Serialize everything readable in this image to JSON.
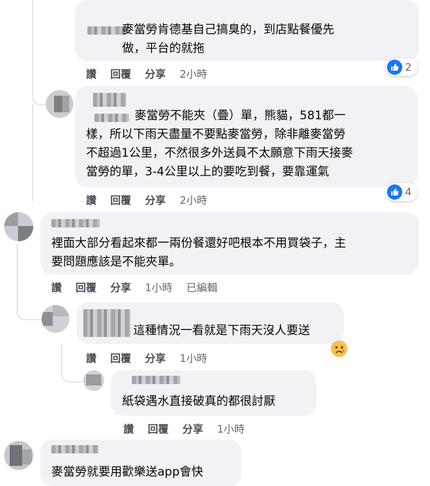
{
  "comments": [
    {
      "text": "麥當勞肯德基自己搞臭的，到店點餐優先\n做，平台的就拖",
      "actions": {
        "like": "讚",
        "reply": "回覆",
        "share": "分享",
        "time": "2小時"
      },
      "reaction_count": "2",
      "reaction_icon": "like-icon"
    },
    {
      "text": "麥當勞不能夾（疊）單，熊貓，581都一\n樣，所以下雨天盡量不要點麥當勞，除非離麥當勞\n不超過1公里，不然很多外送員不太願意下雨天接麥\n當勞的單，3-4公里以上的要吃到餐，要靠運氣",
      "actions": {
        "like": "讚",
        "reply": "回覆",
        "share": "分享",
        "time": "2小時"
      },
      "reaction_count": "4",
      "reaction_icon": "like-icon"
    },
    {
      "text": "裡面大部分看起來都一兩份餐還好吧根本不用買袋子，主\n要問題應該是不能夾單。",
      "actions": {
        "like": "讚",
        "reply": "回覆",
        "share": "分享",
        "time": "1小時",
        "edited": "已編輯"
      }
    },
    {
      "text": "這種情況一看就是下雨天沒人要送",
      "actions": {
        "like": "讚",
        "reply": "回覆",
        "share": "分享",
        "time": "1小時"
      },
      "reaction_icon": "sad-face-emoji"
    },
    {
      "text": "紙袋遇水直接破真的都很討厭",
      "actions": {
        "like": "讚",
        "reply": "回覆",
        "share": "分享",
        "time": "1小時"
      }
    },
    {
      "text": "麥當勞就要用歡樂送app會快"
    }
  ],
  "colors": {
    "bubble": "#f0f2f5",
    "like_blue": "#1877f2",
    "action_gray": "#65676b"
  }
}
